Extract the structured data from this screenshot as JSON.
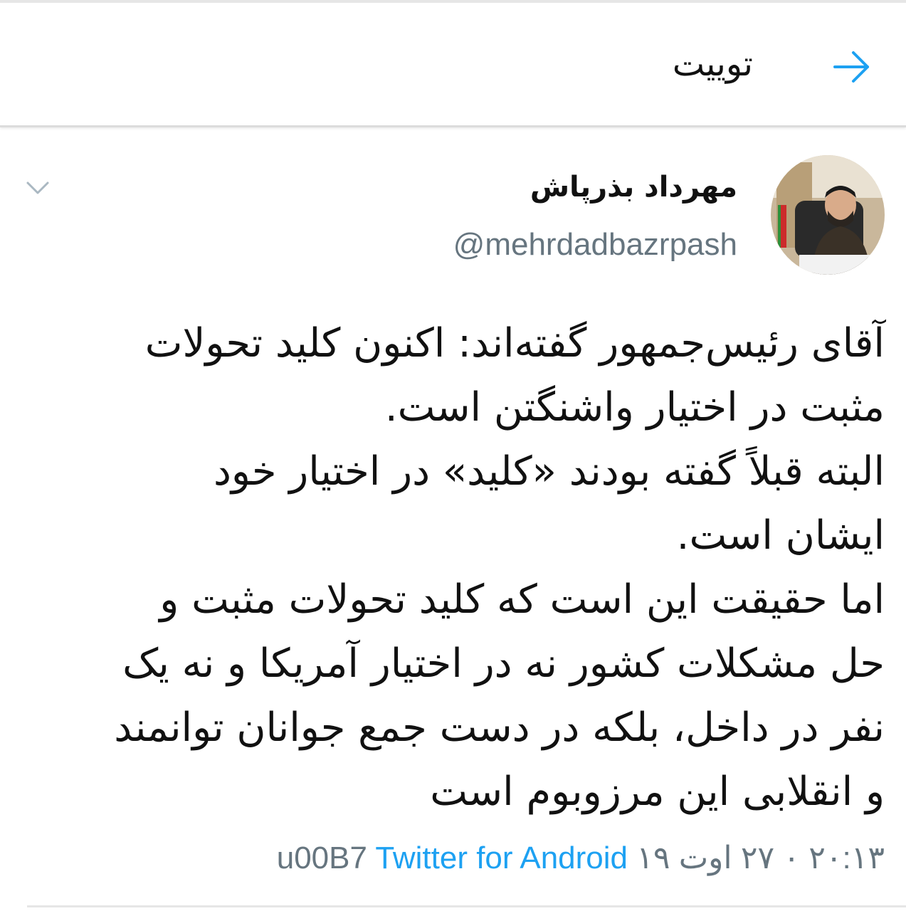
{
  "header": {
    "title": "توییت",
    "back_icon": "arrow-right-icon",
    "accent_color": "#1da1f2"
  },
  "author": {
    "display_name": "مهرداد بذرپاش",
    "handle": "@mehrdadbazrpash",
    "avatar_icon": "profile-photo"
  },
  "menu_icon": "chevron-down-icon",
  "tweet": {
    "lines": [
      "آقای رئیس‌جمهور گفته‌اند: اکنون کلید تحولات",
      "مثبت در اختیار واشنگتن است.",
      "البته قبلاً گفته بودند «کلید» در اختیار خود",
      "ایشان است.",
      "اما حقیقت این است که کلید تحولات مثبت و",
      "حل مشکلات کشور نه در اختیار آمریکا و نه یک",
      "نفر در داخل، بلکه در دست جمع جوانان توانمند",
      "و انقلابی این مرزوبوم است"
    ]
  },
  "meta": {
    "timestamp": "۲۰:۱۳ ۰ ۲۷ اوت ۱۹",
    "separator": "u00B7",
    "source": "Twitter for Android"
  }
}
